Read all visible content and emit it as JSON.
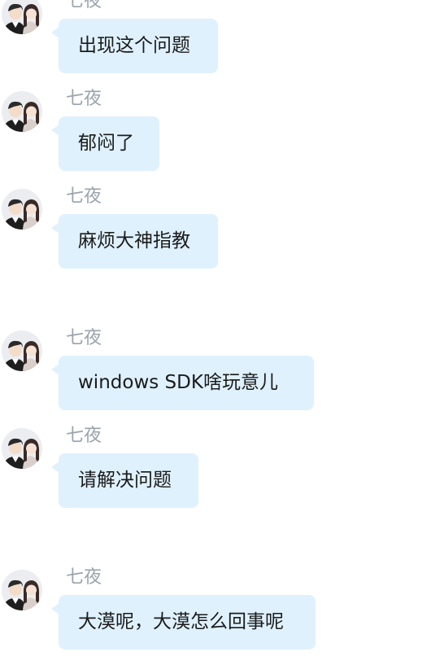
{
  "messages": [
    {
      "sender": "七夜",
      "text": "出现这个问题"
    },
    {
      "sender": "七夜",
      "text": "郁闷了"
    },
    {
      "sender": "七夜",
      "text": "麻烦大神指教"
    },
    {
      "sender": "七夜",
      "text": "windows SDK啥玩意儿"
    },
    {
      "sender": "七夜",
      "text": "请解决问题"
    },
    {
      "sender": "七夜",
      "text": "大漠呢，大漠怎么回事呢"
    }
  ],
  "colors": {
    "bubble": "#dff1fd",
    "sender_name": "#9aa3ad",
    "message_text": "#1b1b1b"
  },
  "icons": {
    "avatar": "couple-avatar-icon"
  }
}
